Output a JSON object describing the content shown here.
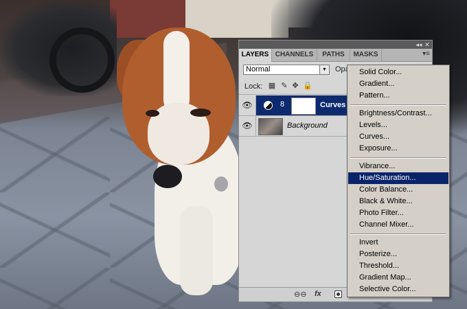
{
  "panel": {
    "tabs": [
      "LAYERS",
      "CHANNELS",
      "PATHS",
      "MASKS"
    ],
    "active_tab": "LAYERS",
    "blend_mode": "Normal",
    "opacity_label": "Opa",
    "lock_label": "Lock:",
    "layers": [
      {
        "name": "Curves",
        "selected": true,
        "visible": true
      },
      {
        "name": "Background",
        "selected": false,
        "visible": true
      }
    ],
    "bottom_fx": "fx"
  },
  "menu": {
    "groups": [
      [
        "Solid Color...",
        "Gradient...",
        "Pattern..."
      ],
      [
        "Brightness/Contrast...",
        "Levels...",
        "Curves...",
        "Exposure..."
      ],
      [
        "Vibrance...",
        "Hue/Saturation...",
        "Color Balance...",
        "Black & White...",
        "Photo Filter...",
        "Channel Mixer..."
      ],
      [
        "Invert",
        "Posterize...",
        "Threshold...",
        "Gradient Map...",
        "Selective Color..."
      ]
    ],
    "highlighted": "Hue/Saturation..."
  },
  "colors": {
    "selection": "#0d2a6e",
    "menu_highlight": "#0a246a",
    "menu_bg": "#d4d0c8"
  }
}
